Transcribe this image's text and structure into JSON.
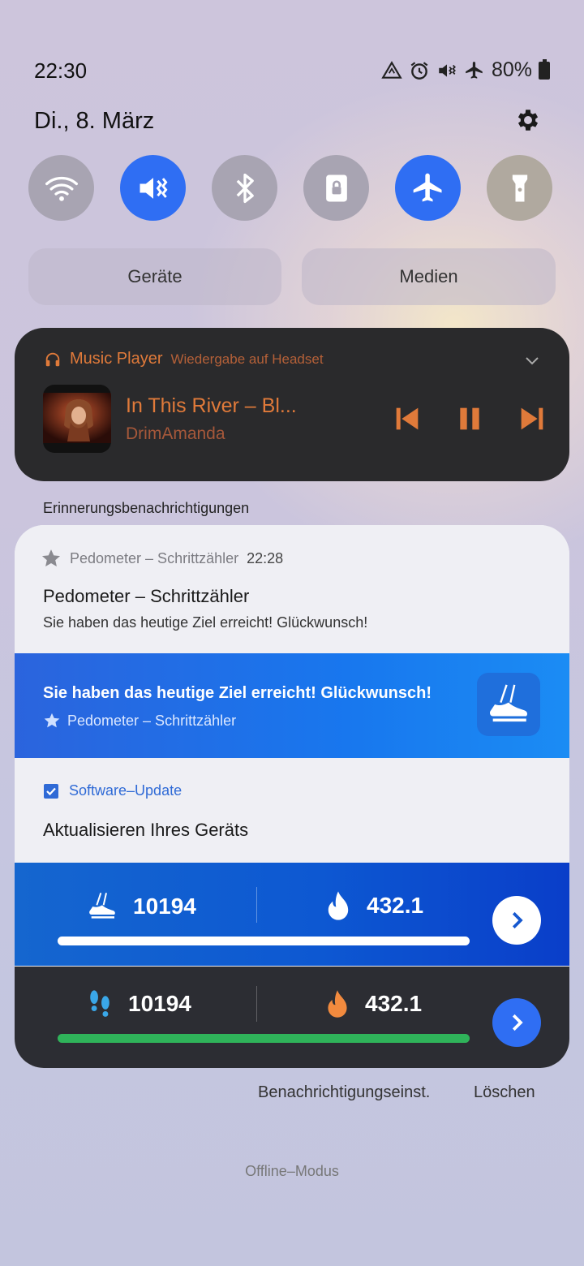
{
  "status_bar": {
    "time": "22:30",
    "battery": "80%"
  },
  "date": "Di., 8. März",
  "quick_settings": {
    "toggles": [
      {
        "name": "wifi",
        "on": false
      },
      {
        "name": "sound-mute",
        "on": true
      },
      {
        "name": "bluetooth",
        "on": false
      },
      {
        "name": "rotation-lock",
        "on": false
      },
      {
        "name": "airplane",
        "on": true
      },
      {
        "name": "flashlight",
        "on": false
      }
    ],
    "devices_label": "Geräte",
    "media_label": "Medien"
  },
  "media": {
    "app": "Music Player",
    "output": "Wiedergabe auf Headset",
    "song": "In This River – Bl...",
    "artist": "DrimAmanda"
  },
  "section_label": "Erinnerungsbenachrichtigungen",
  "notifications": {
    "pedometer": {
      "app": "Pedometer – Schrittzähler",
      "time": "22:28",
      "title": "Pedometer – Schrittzähler",
      "text": "Sie haben das heutige Ziel erreicht! Glückwunsch!"
    },
    "goal": {
      "title": "Sie haben das heutige Ziel erreicht! Glückwunsch!",
      "app": "Pedometer – Schrittzähler"
    },
    "update": {
      "app": "Software–Update",
      "title": "Aktualisieren Ihres Geräts"
    },
    "steps_blue": {
      "steps": "10194",
      "calories": "432.1",
      "progress": 1.0
    },
    "steps_dark": {
      "steps": "10194",
      "calories": "432.1",
      "progress": 1.0
    }
  },
  "actions": {
    "settings": "Benachrichtigungseinst.",
    "clear": "Löschen"
  },
  "footer": "Offline–Modus",
  "colors": {
    "accent": "#2f6ef3",
    "media_accent": "#e07a3a",
    "progress_green": "#2fb35a"
  }
}
